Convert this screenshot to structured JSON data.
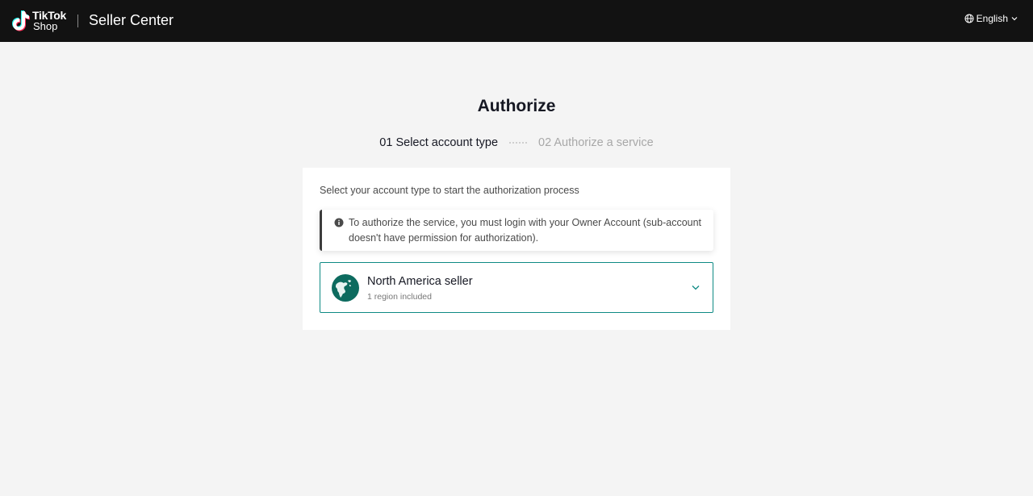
{
  "header": {
    "logo_line1": "TikTok",
    "logo_line2": "Shop",
    "product_name": "Seller Center",
    "language": "English"
  },
  "page": {
    "title": "Authorize",
    "steps": [
      {
        "label": "01 Select account type",
        "state": "active"
      },
      {
        "label": "02 Authorize a service",
        "state": "inactive"
      }
    ]
  },
  "card": {
    "instruction": "Select your account type to start the authorization process",
    "notice": "To authorize the service, you must login with your Owner Account (sub-account doesn't have permission for authorization).",
    "option": {
      "title": "North America seller",
      "subtitle": "1 region included",
      "icon": "globe-icon"
    }
  },
  "colors": {
    "topbar": "#121212",
    "background": "#f4f4f4",
    "accent": "#0e8a84",
    "globe": "#0d6b5f"
  }
}
